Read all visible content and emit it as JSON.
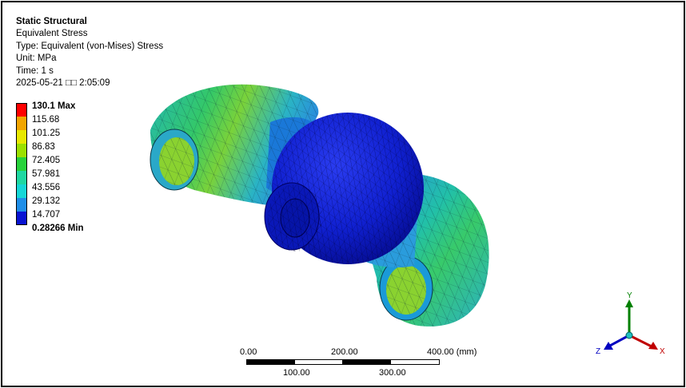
{
  "header": {
    "analysis": "Static Structural",
    "result": "Equivalent Stress",
    "type": "Type: Equivalent (von-Mises) Stress",
    "unit": "Unit: MPa",
    "time": "Time: 1 s",
    "timestamp": "2025-05-21 □□ 2:05:09"
  },
  "legend": {
    "max_label": "130.1 Max",
    "min_label": "0.28266 Min",
    "levels": [
      "115.68",
      "101.25",
      "86.83",
      "72.405",
      "57.981",
      "43.556",
      "29.132",
      "14.707"
    ],
    "colors": [
      "#ff0000",
      "#f2a500",
      "#e8e800",
      "#9be000",
      "#27d23b",
      "#1fd8a2",
      "#15d7d7",
      "#1e8ee8",
      "#0a14d2"
    ]
  },
  "scale_bar": {
    "top_labels": [
      "0.00",
      "200.00",
      "400.00 (mm)"
    ],
    "bottom_labels": [
      "100.00",
      "300.00"
    ]
  },
  "triad": {
    "x_label": "X",
    "y_label": "Y",
    "z_label": "Z",
    "colors": {
      "x": "#c00000",
      "y": "#008000",
      "z": "#0000c0"
    }
  }
}
